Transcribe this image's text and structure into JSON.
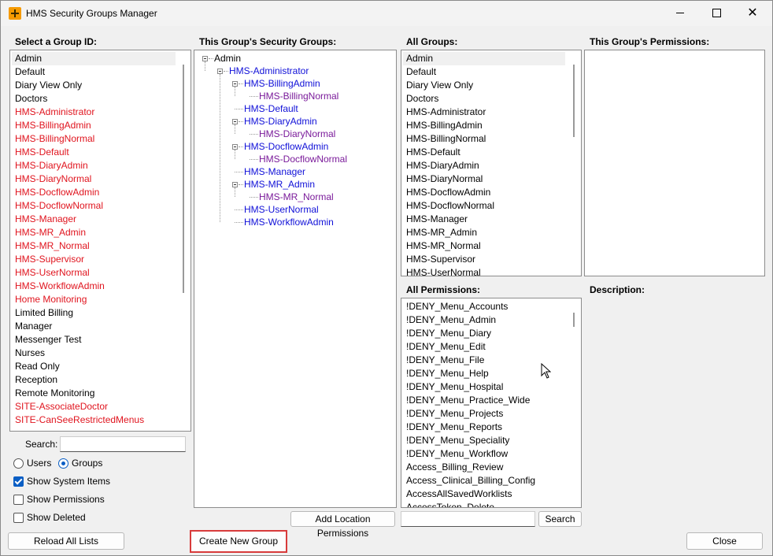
{
  "window": {
    "title": "HMS Security Groups Manager"
  },
  "labels": {
    "select_group": "Select a Group ID:",
    "this_groups_security": "This Group's Security Groups:",
    "all_groups": "All Groups:",
    "this_groups_permissions": "This Group's Permissions:",
    "all_permissions": "All Permissions:",
    "description": "Description:",
    "search": "Search:"
  },
  "group_list": [
    {
      "text": "Admin",
      "red": false,
      "selected": true
    },
    {
      "text": "Default",
      "red": false
    },
    {
      "text": "Diary View Only",
      "red": false
    },
    {
      "text": "Doctors",
      "red": false
    },
    {
      "text": "HMS-Administrator",
      "red": true
    },
    {
      "text": "HMS-BillingAdmin",
      "red": true
    },
    {
      "text": "HMS-BillingNormal",
      "red": true
    },
    {
      "text": "HMS-Default",
      "red": true
    },
    {
      "text": "HMS-DiaryAdmin",
      "red": true
    },
    {
      "text": "HMS-DiaryNormal",
      "red": true
    },
    {
      "text": "HMS-DocflowAdmin",
      "red": true
    },
    {
      "text": "HMS-DocflowNormal",
      "red": true
    },
    {
      "text": "HMS-Manager",
      "red": true
    },
    {
      "text": "HMS-MR_Admin",
      "red": true
    },
    {
      "text": "HMS-MR_Normal",
      "red": true
    },
    {
      "text": "HMS-Supervisor",
      "red": true
    },
    {
      "text": "HMS-UserNormal",
      "red": true
    },
    {
      "text": "HMS-WorkflowAdmin",
      "red": true
    },
    {
      "text": "Home Monitoring",
      "red": true
    },
    {
      "text": "Limited Billing",
      "red": false
    },
    {
      "text": "Manager",
      "red": false
    },
    {
      "text": "Messenger Test",
      "red": false
    },
    {
      "text": "Nurses",
      "red": false
    },
    {
      "text": "Read Only",
      "red": false
    },
    {
      "text": "Reception",
      "red": false
    },
    {
      "text": "Remote Monitoring",
      "red": false
    },
    {
      "text": "SITE-AssociateDoctor",
      "red": true
    },
    {
      "text": "SITE-CanSeeRestrictedMenus",
      "red": true
    }
  ],
  "tree": [
    {
      "text": "Admin",
      "level": 0,
      "color": "black",
      "expander": true
    },
    {
      "text": "HMS-Administrator",
      "level": 1,
      "color": "blue",
      "expander": true
    },
    {
      "text": "HMS-BillingAdmin",
      "level": 2,
      "color": "blue",
      "expander": true
    },
    {
      "text": "HMS-BillingNormal",
      "level": 3,
      "color": "purple",
      "expander": false
    },
    {
      "text": "HMS-Default",
      "level": 2,
      "color": "blue",
      "expander": false
    },
    {
      "text": "HMS-DiaryAdmin",
      "level": 2,
      "color": "blue",
      "expander": true
    },
    {
      "text": "HMS-DiaryNormal",
      "level": 3,
      "color": "purple",
      "expander": false
    },
    {
      "text": "HMS-DocflowAdmin",
      "level": 2,
      "color": "blue",
      "expander": true
    },
    {
      "text": "HMS-DocflowNormal",
      "level": 3,
      "color": "purple",
      "expander": false
    },
    {
      "text": "HMS-Manager",
      "level": 2,
      "color": "blue",
      "expander": false
    },
    {
      "text": "HMS-MR_Admin",
      "level": 2,
      "color": "blue",
      "expander": true
    },
    {
      "text": "HMS-MR_Normal",
      "level": 3,
      "color": "purple",
      "expander": false
    },
    {
      "text": "HMS-UserNormal",
      "level": 2,
      "color": "blue",
      "expander": false
    },
    {
      "text": "HMS-WorkflowAdmin",
      "level": 2,
      "color": "blue",
      "expander": false
    }
  ],
  "all_groups": [
    "Admin",
    "Default",
    "Diary View Only",
    "Doctors",
    "HMS-Administrator",
    "HMS-BillingAdmin",
    "HMS-BillingNormal",
    "HMS-Default",
    "HMS-DiaryAdmin",
    "HMS-DiaryNormal",
    "HMS-DocflowAdmin",
    "HMS-DocflowNormal",
    "HMS-Manager",
    "HMS-MR_Admin",
    "HMS-MR_Normal",
    "HMS-Supervisor",
    "HMS-UserNormal"
  ],
  "all_permissions": [
    "!DENY_Menu_Accounts",
    "!DENY_Menu_Admin",
    "!DENY_Menu_Diary",
    "!DENY_Menu_Edit",
    "!DENY_Menu_File",
    "!DENY_Menu_Help",
    "!DENY_Menu_Hospital",
    "!DENY_Menu_Practice_Wide",
    "!DENY_Menu_Projects",
    "!DENY_Menu_Reports",
    "!DENY_Menu_Speciality",
    "!DENY_Menu_Workflow",
    "Access_Billing_Review",
    "Access_Clinical_Billing_Config",
    "AccessAllSavedWorklists",
    "AccessToken_Delete"
  ],
  "options": {
    "users": "Users",
    "groups": "Groups",
    "show_system_items": "Show System Items",
    "show_permissions": "Show Permissions",
    "show_deleted": "Show Deleted"
  },
  "buttons": {
    "add_location_permissions": "Add Location Permissions",
    "search": "Search",
    "reload_all_lists": "Reload All Lists",
    "create_new_group": "Create New Group",
    "close": "Close"
  },
  "search": {
    "value": "",
    "perm_value": ""
  }
}
